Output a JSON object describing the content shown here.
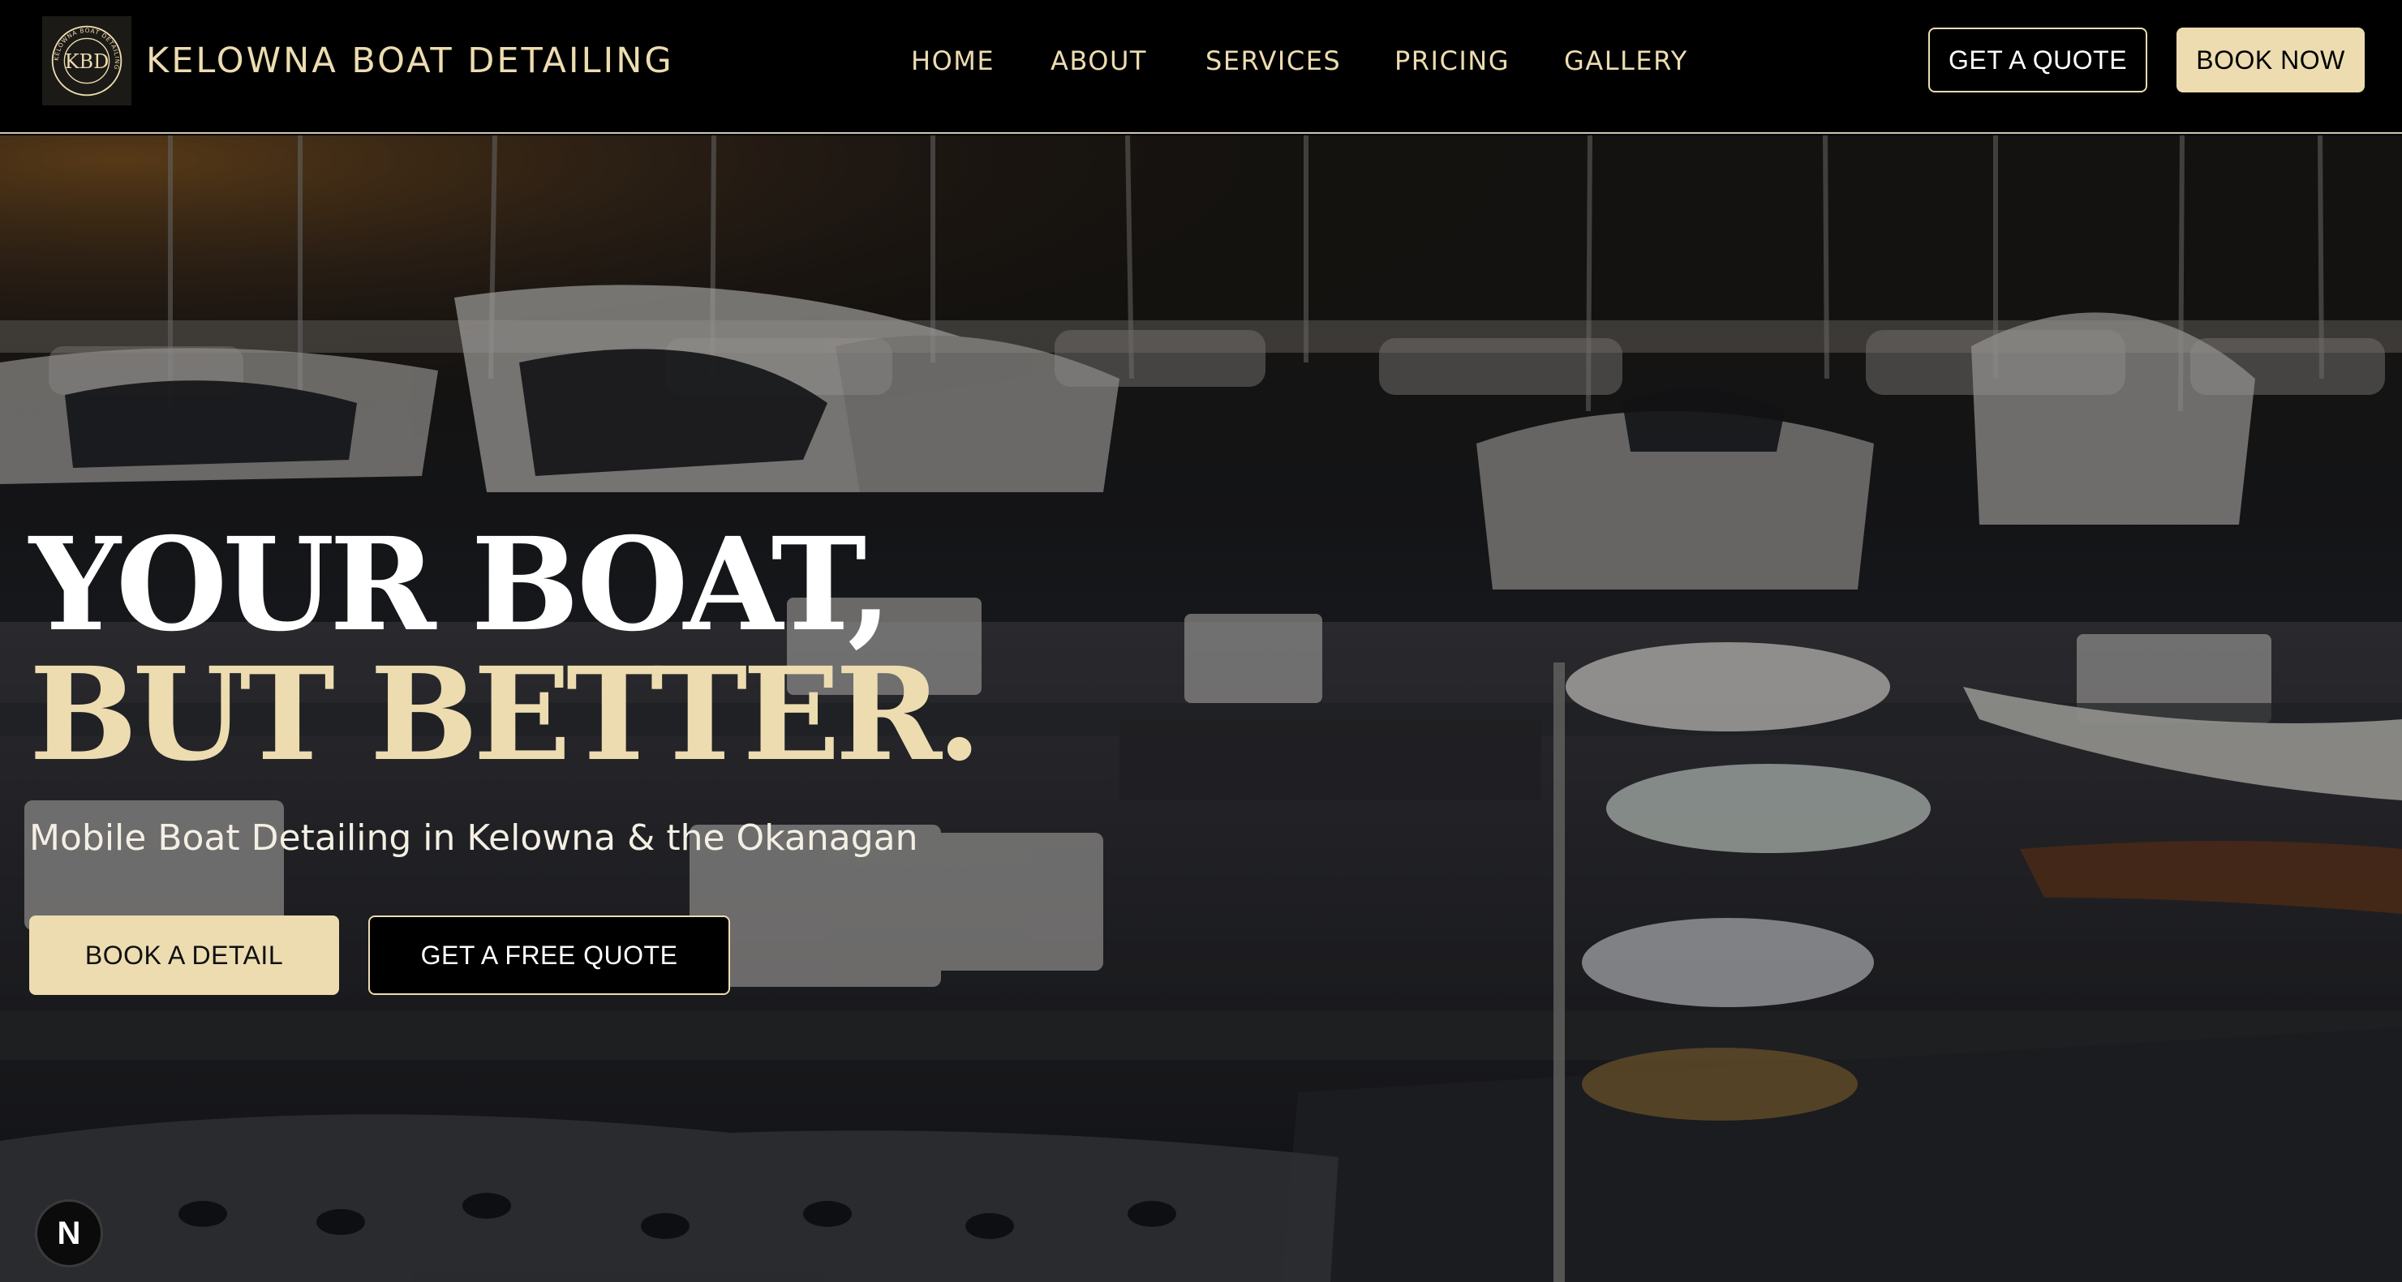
{
  "header": {
    "brand": "KELOWNA BOAT DETAILING",
    "logo_icon": "boat-detailing-seal-logo",
    "logo_monogram": "KBD",
    "logo_ring_text": "KELOWNA BOAT DETAILING",
    "nav": [
      "HOME",
      "ABOUT",
      "SERVICES",
      "PRICING",
      "GALLERY"
    ],
    "quote_label": "GET A QUOTE",
    "book_label": "BOOK NOW"
  },
  "hero": {
    "headline_line1": "YOUR BOAT,",
    "headline_line2": "BUT BETTER.",
    "subtitle": "Mobile Boat Detailing in Kelowna & the Okanagan",
    "primary_cta": "BOOK A DETAIL",
    "secondary_cta": "GET A FREE QUOTE",
    "background_image": "marina-at-sunset-photo"
  },
  "dev_badge": {
    "label": "N",
    "icon": "nextjs-icon"
  },
  "colors": {
    "accent": "#ecdcb0",
    "background": "#000000",
    "text_light": "#ffffff"
  }
}
